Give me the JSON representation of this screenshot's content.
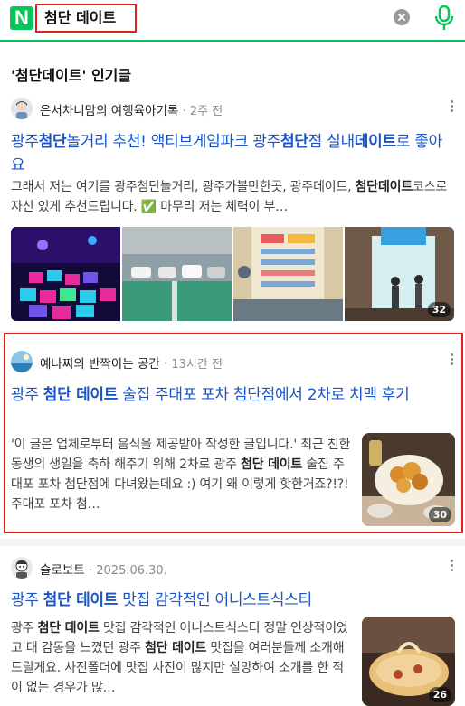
{
  "header": {
    "logo": "N",
    "query": "첨단 데이트"
  },
  "section": {
    "title": "'첨단데이트' 인기글"
  },
  "posts": [
    {
      "author": "은서차니맘의 여행육아기록",
      "time": "2주 전",
      "title_parts": [
        "광주",
        "첨단",
        "놀거리 추천! 액티브게임파크 광주",
        "첨단",
        "점 실내",
        "데이트",
        "로 좋아요"
      ],
      "desc_parts": [
        "그래서 저는 여기를 광주첨단놀거리, 광주가볼만한곳, 광주데이트, ",
        "첨단데이트",
        "코스로 자신 있게 추천드립니다. ✅ 마무리 저는 체력이 부…"
      ],
      "image_count": "32"
    },
    {
      "author": "예나찌의 반짝이는 공간",
      "time": "13시간 전",
      "title_parts": [
        "광주 ",
        "첨단 데이트",
        " 술집 주대포 포차 첨단점에서 2차로 치맥 후기"
      ],
      "desc_parts": [
        "'이 글은 업체로부터 음식을 제공받아 작성한 글입니다.' 최근 친한 동생의 생일을 축하 해주기 위해 2차로 광주 ",
        "첨단 데이트",
        " 술집 주대포 포차 첨단점에 다녀왔는데요 :) 여기 왜 이렇게 핫한거죠?!?! 주대포 포차 첨…"
      ],
      "image_count": "30"
    },
    {
      "author": "슬로보트",
      "time": "2025.06.30.",
      "title_parts": [
        "광주 ",
        "첨단 데이트",
        " 맛집 감각적인 어니스트식스티"
      ],
      "desc_parts": [
        "광주 ",
        "첨단 데이트",
        " 맛집 감각적인 어니스트식스티 정말 인상적이었고 대 감동을 느꼈던 광주 ",
        "첨단 데이트",
        " 맛집을 여러분들께 소개해 드릴게요. 사진폴더에 맛집 사진이 많지만 실망하여 소개를 한 적이 없는 경우가 많…"
      ],
      "image_count": "26"
    }
  ],
  "colors": {
    "brand_green": "#03c75a",
    "link_blue": "#1a55c9",
    "highlight_red": "#e0201e"
  },
  "icons": {
    "clear": "clear-icon",
    "mic": "microphone-icon",
    "more": "more-vertical-icon"
  }
}
